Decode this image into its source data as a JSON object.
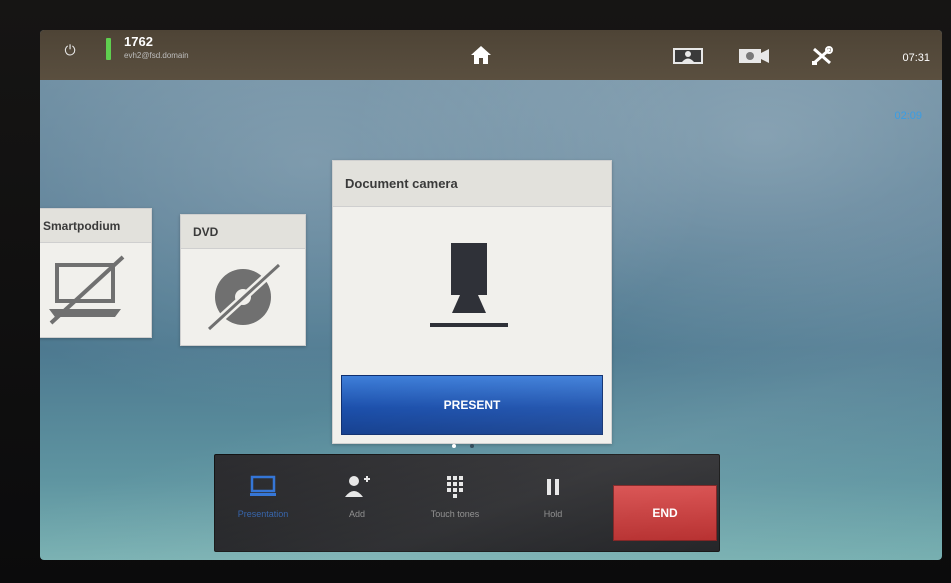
{
  "topbar": {
    "site_number": "1762",
    "site_address": "evh2@fsd.domain",
    "time": "07:31",
    "icons": [
      "power-icon",
      "signal-icon",
      "home-icon",
      "selfview-icon",
      "camera-icon",
      "settings-icon"
    ]
  },
  "call_duration": "02:09",
  "sources": [
    {
      "label": "Smartpodium",
      "icon": "laptop-disconnected-icon"
    },
    {
      "label": "DVD",
      "icon": "disc-disconnected-icon"
    },
    {
      "label": "Document camera",
      "icon": "document-camera-icon",
      "action_label": "PRESENT"
    }
  ],
  "pager": {
    "pages": 2,
    "active": 1
  },
  "toolbar": {
    "items": [
      {
        "label": "Presentation",
        "icon": "presentation-icon"
      },
      {
        "label": "Add",
        "icon": "add-participant-icon"
      },
      {
        "label": "Touch tones",
        "icon": "keypad-icon"
      },
      {
        "label": "Hold",
        "icon": "hold-icon"
      }
    ],
    "end_label": "END"
  },
  "colors": {
    "accent": "#1b4fab",
    "end": "#c43333",
    "status_green": "#5fcf4f",
    "duration": "#3b9de3"
  }
}
